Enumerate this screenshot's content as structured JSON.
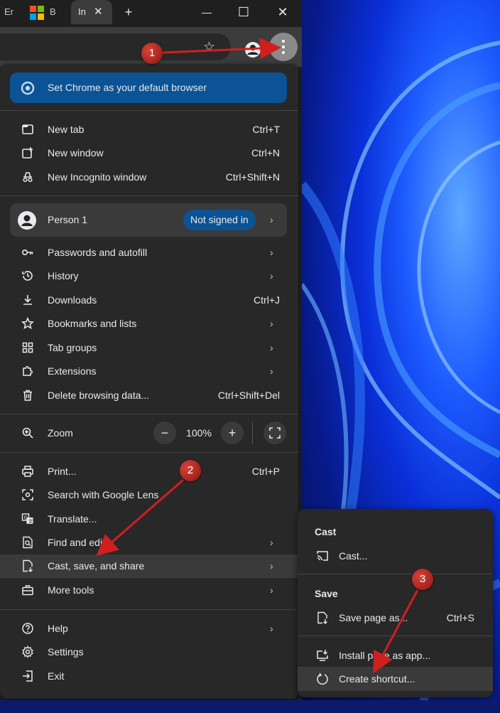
{
  "tabs": [
    {
      "label": "Er"
    },
    {
      "label": "B"
    },
    {
      "label": "In"
    }
  ],
  "window": {
    "new_tab_symbol": "+",
    "minimize_symbol": "—",
    "maximize_symbol": "☐",
    "close_symbol": "✕"
  },
  "menu": {
    "banner": "Set Chrome as your default browser",
    "group1": [
      {
        "label": "New tab",
        "shortcut": "Ctrl+T",
        "icon": "new-tab-icon"
      },
      {
        "label": "New window",
        "shortcut": "Ctrl+N",
        "icon": "new-window-icon"
      },
      {
        "label": "New Incognito window",
        "shortcut": "Ctrl+Shift+N",
        "icon": "incognito-icon"
      }
    ],
    "profile": {
      "name": "Person 1",
      "status": "Not signed in"
    },
    "group2": [
      {
        "label": "Passwords and autofill",
        "icon": "key-icon",
        "submenu": true
      },
      {
        "label": "History",
        "icon": "history-icon",
        "submenu": true
      },
      {
        "label": "Downloads",
        "shortcut": "Ctrl+J",
        "icon": "download-icon"
      },
      {
        "label": "Bookmarks and lists",
        "icon": "star-icon",
        "submenu": true
      },
      {
        "label": "Tab groups",
        "icon": "tab-groups-icon",
        "submenu": true
      },
      {
        "label": "Extensions",
        "icon": "puzzle-icon",
        "submenu": true
      },
      {
        "label": "Delete browsing data...",
        "shortcut": "Ctrl+Shift+Del",
        "icon": "trash-icon"
      }
    ],
    "zoom": {
      "label": "Zoom",
      "value": "100%",
      "minus": "−",
      "plus": "+"
    },
    "group3": [
      {
        "label": "Print...",
        "shortcut": "Ctrl+P",
        "icon": "print-icon"
      },
      {
        "label": "Search with Google Lens",
        "icon": "lens-icon"
      },
      {
        "label": "Translate...",
        "icon": "translate-icon"
      },
      {
        "label": "Find and edit",
        "icon": "find-icon",
        "submenu": true
      },
      {
        "label": "Cast, save, and share",
        "icon": "cast-save-icon",
        "submenu": true
      },
      {
        "label": "More tools",
        "icon": "toolbox-icon",
        "submenu": true
      }
    ],
    "group4": [
      {
        "label": "Help",
        "icon": "help-icon",
        "submenu": true
      },
      {
        "label": "Settings",
        "icon": "gear-icon"
      },
      {
        "label": "Exit",
        "icon": "exit-icon"
      }
    ],
    "arrow": "›"
  },
  "submenu": {
    "cast_heading": "Cast",
    "cast_item": "Cast...",
    "save_heading": "Save",
    "save_page": {
      "label": "Save page as...",
      "shortcut": "Ctrl+S"
    },
    "install_app": "Install page as app...",
    "create_shortcut": "Create shortcut..."
  },
  "annotations": {
    "step1": "1",
    "step2": "2",
    "step3": "3"
  },
  "colors": {
    "accent": "#0b5394",
    "callout": "#c0261f",
    "menu_bg": "#282828"
  }
}
